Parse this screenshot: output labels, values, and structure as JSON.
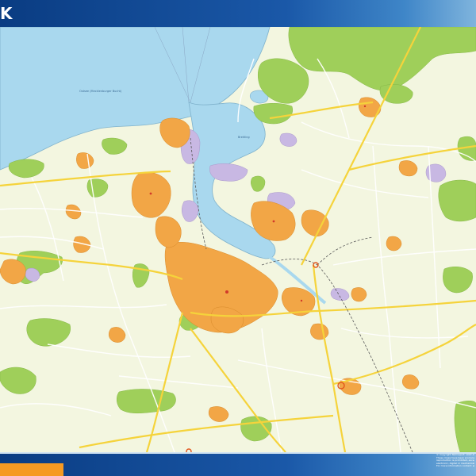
{
  "header": {
    "title": "K"
  },
  "map": {
    "labels": {
      "sea": "Ostsee (Mecklenburger Bucht)",
      "lake": "Breitling"
    }
  },
  "footer": {
    "copyright_lines": [
      "© Copyright Netmaps® 1997-2015",
      "These maps have been produced by",
      "reproduction is prohibited, except",
      "electronic, digital or mechanical,",
      "For more information contact: www"
    ]
  },
  "colors": {
    "sea": "#a9d8ee",
    "land": "#f3f6e0",
    "urban": "#f2a646",
    "forest": "#9fcf5a",
    "industrial": "#c8b8e3",
    "road_major": "#f5d33b",
    "road_minor": "#ffffff",
    "header": "#0a3c82",
    "footer_accent": "#f59a23"
  }
}
